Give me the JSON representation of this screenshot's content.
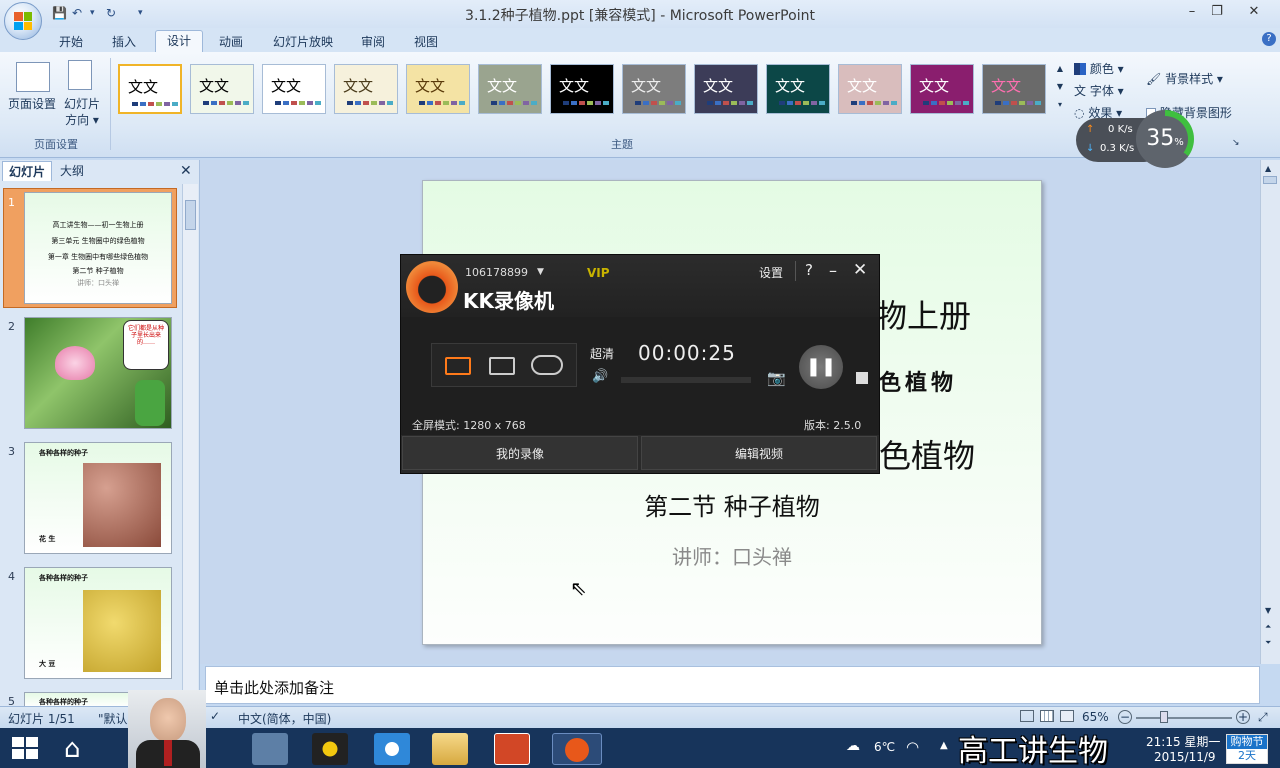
{
  "window": {
    "title": "3.1.2种子植物.ppt [兼容模式] - Microsoft PowerPoint"
  },
  "tabs": [
    "开始",
    "插入",
    "设计",
    "动画",
    "幻灯片放映",
    "审阅",
    "视图"
  ],
  "ribbon": {
    "page_setup": {
      "page_setup_label": "页面设置",
      "orientation_label_1": "幻灯片",
      "orientation_label_2": "方向",
      "group_label": "页面设置"
    },
    "themes": {
      "group_label": "主题",
      "items": [
        {
          "label": "文文",
          "bg": "#ffffff",
          "fg": "#000000"
        },
        {
          "label": "文文",
          "bg": "#f1f7ea",
          "fg": "#000000"
        },
        {
          "label": "文文",
          "bg": "#ffffff",
          "fg": "#000000"
        },
        {
          "label": "文文",
          "bg": "#f6f1dc",
          "fg": "#4a3b1a"
        },
        {
          "label": "文文",
          "bg": "#f4e3a4",
          "fg": "#5a3a0a"
        },
        {
          "label": "文文",
          "bg": "#9aa48f",
          "fg": "#ffffff"
        },
        {
          "label": "文文",
          "bg": "#000000",
          "fg": "#ffffff"
        },
        {
          "label": "文文",
          "bg": "#7d7d7d",
          "fg": "#eeeeee"
        },
        {
          "label": "文文",
          "bg": "#3c3c58",
          "fg": "#ffffff"
        },
        {
          "label": "文文",
          "bg": "#0c4747",
          "fg": "#ffffff"
        },
        {
          "label": "文文",
          "bg": "#d9bdbd",
          "fg": "#ffffff"
        },
        {
          "label": "文文",
          "bg": "#8a1e6e",
          "fg": "#ffffff"
        },
        {
          "label": "文文",
          "bg": "#6a6a6a",
          "fg": "#ff6fb0"
        }
      ]
    },
    "colors_label": "颜色",
    "fonts_label": "字体",
    "effects_label": "效果",
    "bg_style_label": "背景样式",
    "hide_bg_label": "隐藏背景图形"
  },
  "panel": {
    "tab_slides": "幻灯片",
    "tab_outline": "大纲"
  },
  "thumbnails": [
    {
      "num": "1",
      "lines": [
        "高工讲生物——初一生物上册",
        "第三单元 生物圈中的绿色植物",
        "第一章 生物圈中有哪些绿色植物",
        "第二节 种子植物",
        "讲师：口头禅"
      ]
    },
    {
      "num": "2",
      "lines": [
        "它们都是从种子里长出来的……"
      ]
    },
    {
      "num": "3",
      "lines": [
        "各种各样的种子",
        "花 生"
      ]
    },
    {
      "num": "4",
      "lines": [
        "各种各样的种子",
        "大 豆"
      ]
    },
    {
      "num": "5",
      "lines": [
        "各种各样的种子"
      ]
    }
  ],
  "slide": {
    "line1": "物上册",
    "line2": "色植物",
    "line3": "色植物",
    "line4": "第二节 种子植物",
    "line5": "讲师：口头禅"
  },
  "notes_placeholder": "单击此处添加备注",
  "status": {
    "slide_info": "幻灯片 1/51",
    "theme": "\"默认",
    "lang": "中文(简体，中国)",
    "zoom": "65%"
  },
  "kk": {
    "user_id": "106178899",
    "vip": "VIP",
    "brand": "KK录像机",
    "settings": "设置",
    "help": "?",
    "quality": "超清",
    "timer": "00:00:25",
    "mode": "全屏模式: 1280 x 768",
    "version": "版本: 2.5.0",
    "my_recordings": "我的录像",
    "edit_video": "编辑视频"
  },
  "net": {
    "up": "0",
    "up_unit": "K/s",
    "down": "0.3",
    "down_unit": "K/s",
    "cpu": "35",
    "cpu_unit": "%"
  },
  "taskbar": {
    "weather": "6℃",
    "time": "21:15 星期一",
    "date": "2015/11/9",
    "badge_title": "购物节",
    "badge_days": "2天"
  },
  "overlay_caption": "高工讲生物"
}
